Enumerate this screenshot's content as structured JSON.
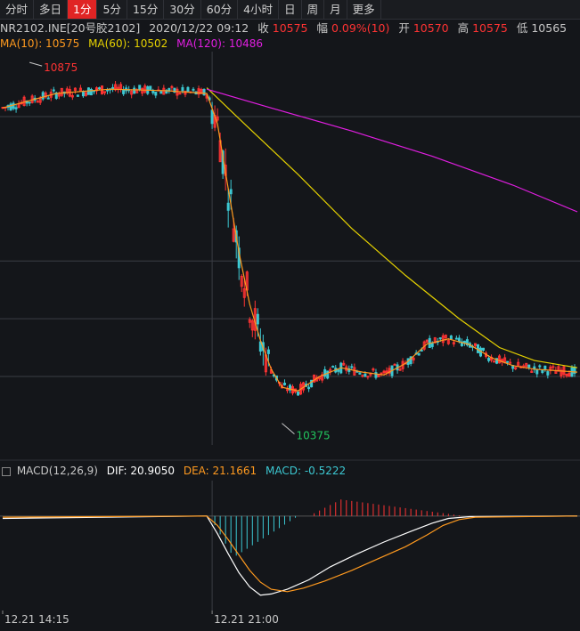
{
  "tabs": [
    {
      "label": "分时",
      "active": false
    },
    {
      "label": "多日",
      "active": false
    },
    {
      "label": "1分",
      "active": true
    },
    {
      "label": "5分",
      "active": false
    },
    {
      "label": "15分",
      "active": false
    },
    {
      "label": "30分",
      "active": false
    },
    {
      "label": "60分",
      "active": false
    },
    {
      "label": "4小时",
      "active": false
    },
    {
      "label": "日",
      "active": false
    },
    {
      "label": "周",
      "active": false
    },
    {
      "label": "月",
      "active": false
    },
    {
      "label": "更多",
      "active": false
    }
  ],
  "quote": {
    "symbol": "NR2102.INE[20号胶2102]",
    "datetime": "2020/12/22 09:12",
    "close_label": "收",
    "close": "10575",
    "change_label": "幅",
    "change": "0.09%(10)",
    "open_label": "开",
    "open": "10570",
    "high_label": "高",
    "high": "10575",
    "low_label": "低",
    "low": "10565"
  },
  "ma": {
    "ma10_label": "MA(10): 10575",
    "ma60_label": "MA(60): 10502",
    "ma120_label": "MA(120): 10486"
  },
  "macd": {
    "name": "MACD(12,26,9)",
    "dif": "DIF: 20.9050",
    "dea": "DEA: 21.1661",
    "macd": "MACD: -0.5222"
  },
  "colors": {
    "up": "#ff3333",
    "down": "#3cc8d2",
    "ma10": "#ff9a1f",
    "ma60": "#e6d200",
    "ma120": "#e01ee0",
    "dif": "#ffffff",
    "dea": "#ff9a1f",
    "grid": "#3a3d44"
  },
  "chart_data": {
    "type": "line",
    "title": "",
    "price_range": [
      10345,
      10890
    ],
    "annotations": [
      {
        "label": "10875",
        "x_index": 10,
        "value": 10875,
        "kind": "high"
      },
      {
        "label": "10375",
        "x_index": 104,
        "value": 10375,
        "kind": "low"
      }
    ],
    "x_tick_labels": [
      {
        "label": "12.21 14:15",
        "x_index": 0
      },
      {
        "label": "12.21 21:00",
        "x_index": 78
      }
    ],
    "series": [
      {
        "key": "ma10",
        "points": [
          [
            0,
            10812
          ],
          [
            10,
            10822
          ],
          [
            20,
            10832
          ],
          [
            40,
            10838
          ],
          [
            60,
            10836
          ],
          [
            76,
            10832
          ],
          [
            80,
            10790
          ],
          [
            84,
            10700
          ],
          [
            88,
            10612
          ],
          [
            92,
            10540
          ],
          [
            96,
            10490
          ],
          [
            100,
            10450
          ],
          [
            104,
            10425
          ],
          [
            110,
            10420
          ],
          [
            118,
            10440
          ],
          [
            126,
            10452
          ],
          [
            134,
            10446
          ],
          [
            142,
            10442
          ],
          [
            150,
            10458
          ],
          [
            158,
            10485
          ],
          [
            166,
            10492
          ],
          [
            174,
            10484
          ],
          [
            182,
            10466
          ],
          [
            190,
            10455
          ],
          [
            198,
            10450
          ],
          [
            214,
            10446
          ]
        ]
      },
      {
        "key": "ma60",
        "points": [
          [
            76,
            10840
          ],
          [
            90,
            10790
          ],
          [
            110,
            10720
          ],
          [
            130,
            10645
          ],
          [
            150,
            10580
          ],
          [
            170,
            10520
          ],
          [
            185,
            10480
          ],
          [
            198,
            10462
          ],
          [
            214,
            10452
          ]
        ]
      },
      {
        "key": "ma120",
        "points": [
          [
            76,
            10838
          ],
          [
            100,
            10812
          ],
          [
            130,
            10780
          ],
          [
            160,
            10745
          ],
          [
            190,
            10705
          ],
          [
            214,
            10668
          ]
        ]
      }
    ],
    "macd_range": [
      -8,
      3
    ],
    "macd_lines": [
      {
        "key": "dif",
        "points": [
          [
            0,
            -0.2
          ],
          [
            76,
            0
          ],
          [
            80,
            -1.5
          ],
          [
            84,
            -3.2
          ],
          [
            88,
            -4.8
          ],
          [
            92,
            -6.0
          ],
          [
            96,
            -6.7
          ],
          [
            100,
            -6.6
          ],
          [
            106,
            -6.2
          ],
          [
            114,
            -5.4
          ],
          [
            122,
            -4.3
          ],
          [
            132,
            -3.2
          ],
          [
            142,
            -2.2
          ],
          [
            152,
            -1.3
          ],
          [
            160,
            -0.6
          ],
          [
            166,
            -0.2
          ],
          [
            174,
            -0.05
          ],
          [
            214,
            0
          ]
        ]
      },
      {
        "key": "dea",
        "points": [
          [
            0,
            -0.1
          ],
          [
            76,
            0
          ],
          [
            80,
            -0.8
          ],
          [
            84,
            -2.0
          ],
          [
            88,
            -3.3
          ],
          [
            92,
            -4.6
          ],
          [
            96,
            -5.6
          ],
          [
            100,
            -6.2
          ],
          [
            106,
            -6.4
          ],
          [
            112,
            -6.1
          ],
          [
            120,
            -5.5
          ],
          [
            130,
            -4.6
          ],
          [
            140,
            -3.6
          ],
          [
            150,
            -2.6
          ],
          [
            158,
            -1.6
          ],
          [
            164,
            -0.8
          ],
          [
            170,
            -0.3
          ],
          [
            176,
            -0.1
          ],
          [
            214,
            0
          ]
        ]
      }
    ],
    "macd_hist": [
      {
        "start": 77,
        "end": 110,
        "peak_index": 86,
        "peak": -3.5
      },
      {
        "start": 114,
        "end": 172,
        "peak_index": 126,
        "peak": 1.4
      }
    ],
    "candle_count": 214
  }
}
